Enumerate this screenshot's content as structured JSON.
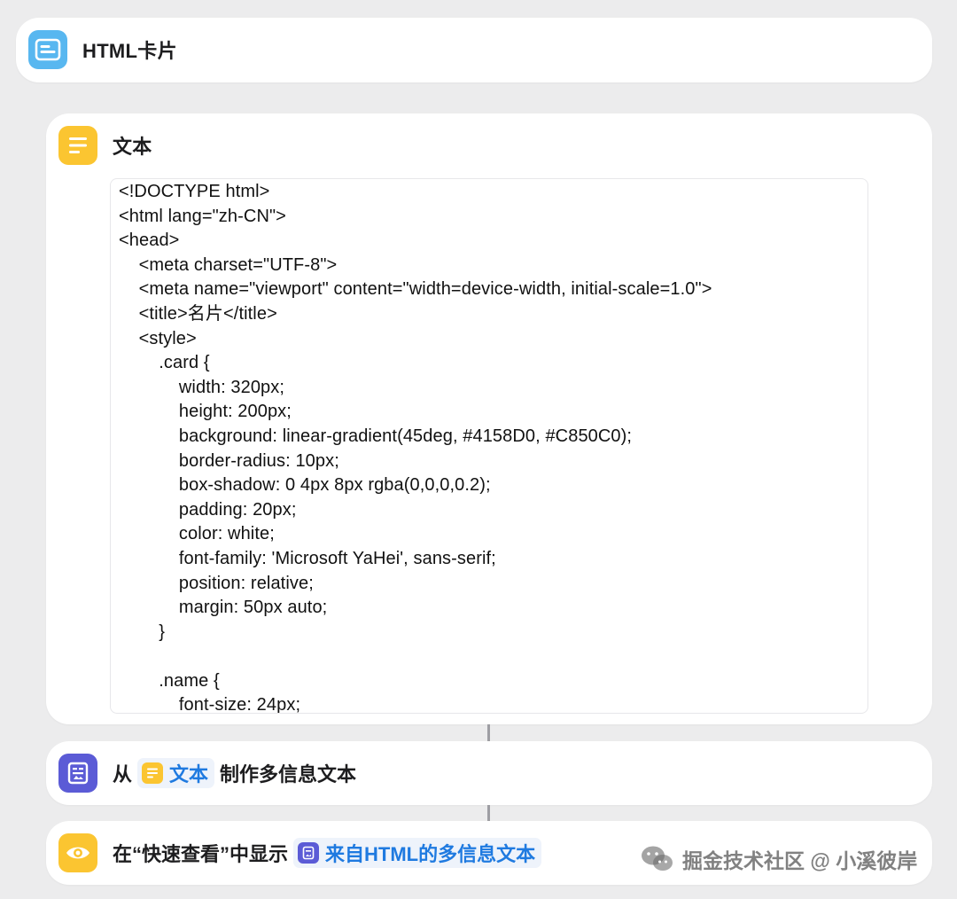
{
  "cards": {
    "html_card": {
      "title": "HTML卡片"
    },
    "text_card": {
      "title": "文本",
      "code_lines": [
        "<!DOCTYPE html>",
        "<html lang=\"zh-CN\">",
        "<head>",
        "    <meta charset=\"UTF-8\">",
        "    <meta name=\"viewport\" content=\"width=device-width, initial-scale=1.0\">",
        "    <title>名片</title>",
        "    <style>",
        "        .card {",
        "            width: 320px;",
        "            height: 200px;",
        "            background: linear-gradient(45deg, #4158D0, #C850C0);",
        "            border-radius: 10px;",
        "            box-shadow: 0 4px 8px rgba(0,0,0,0.2);",
        "            padding: 20px;",
        "            color: white;",
        "            font-family: 'Microsoft YaHei', sans-serif;",
        "            position: relative;",
        "            margin: 50px auto;",
        "        }",
        "",
        "        .name {",
        "            font-size: 24px;"
      ]
    },
    "rich_text_card": {
      "prefix": "从",
      "token_label": "文本",
      "suffix": "制作多信息文本"
    },
    "quicklook_card": {
      "prefix": "在“快速查看”中显示",
      "token_label": "来自HTML的多信息文本"
    }
  },
  "watermark": {
    "text": "掘金技术社区 @ 小溪彼岸"
  },
  "colors": {
    "background": "#ececed",
    "blue_icon": "#58b7f0",
    "yellow_icon": "#fbc531",
    "indigo_icon": "#5b5bd6",
    "token_text": "#1f7ae0"
  },
  "icons": {
    "html_card": "card-icon",
    "text_card": "text-lines-icon",
    "rich_text_card": "rich-text-icon",
    "quicklook_card": "eye-icon",
    "watermark": "wechat-icon"
  }
}
